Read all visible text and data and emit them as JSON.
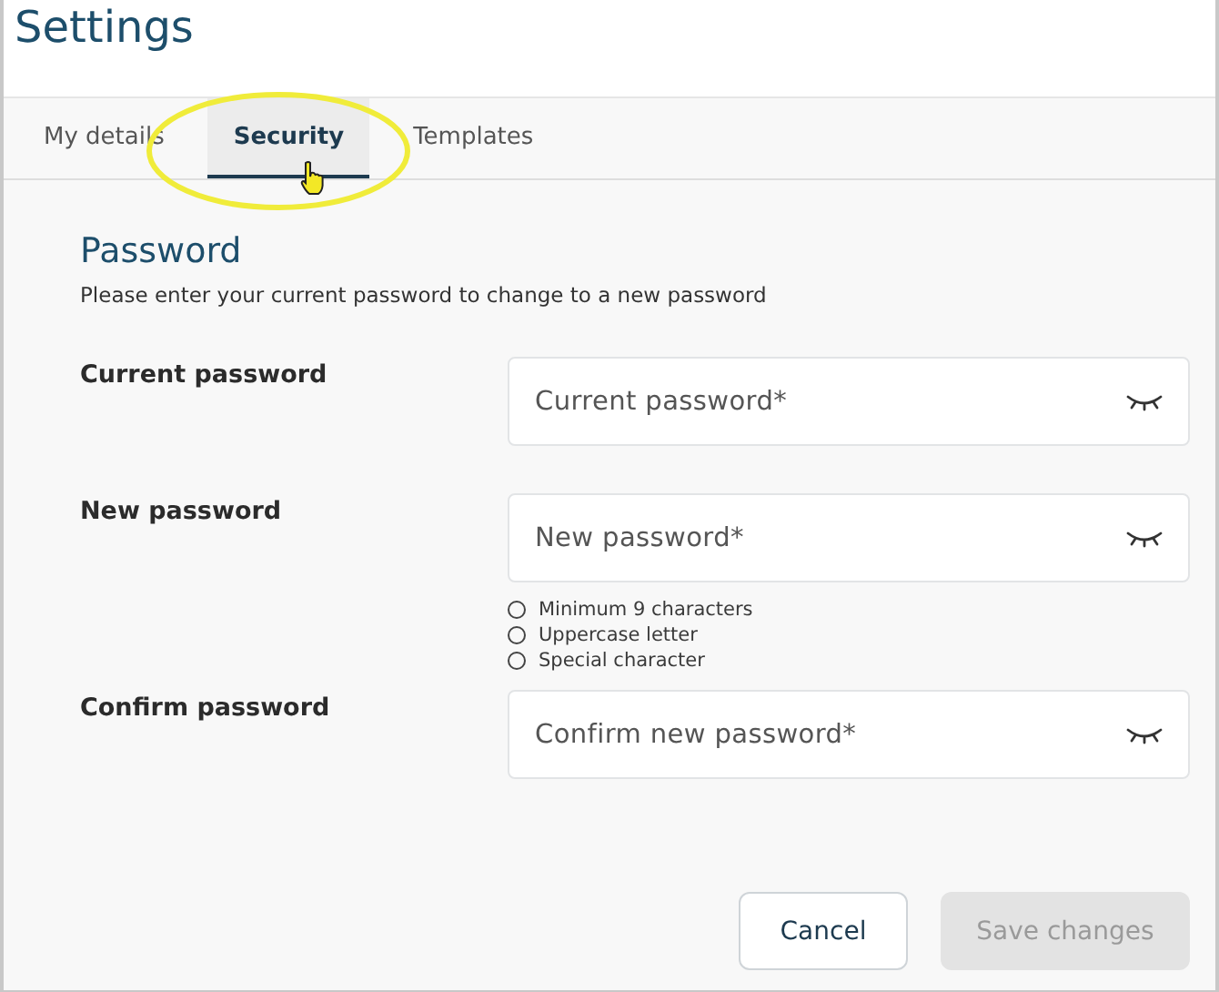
{
  "page_title": "Settings",
  "tabs": [
    {
      "label": "My details",
      "selected": false
    },
    {
      "label": "Security",
      "selected": true
    },
    {
      "label": "Templates",
      "selected": false
    }
  ],
  "section": {
    "heading": "Password",
    "description": "Please enter your current password to change to a new password"
  },
  "fields": [
    {
      "label": "Current password",
      "placeholder": "Current password*"
    },
    {
      "label": "New password",
      "placeholder": "New password*",
      "requirements": [
        {
          "text": "Minimum 9 characters",
          "checked": false
        },
        {
          "text": "Uppercase letter",
          "checked": false
        },
        {
          "text": "Special character",
          "checked": false
        }
      ]
    },
    {
      "label": "Confirm password",
      "placeholder": "Confirm new password*"
    }
  ],
  "buttons": [
    {
      "label": "Cancel",
      "kind": "secondary",
      "disabled": false
    },
    {
      "label": "Save changes",
      "kind": "primary",
      "disabled": true
    }
  ]
}
